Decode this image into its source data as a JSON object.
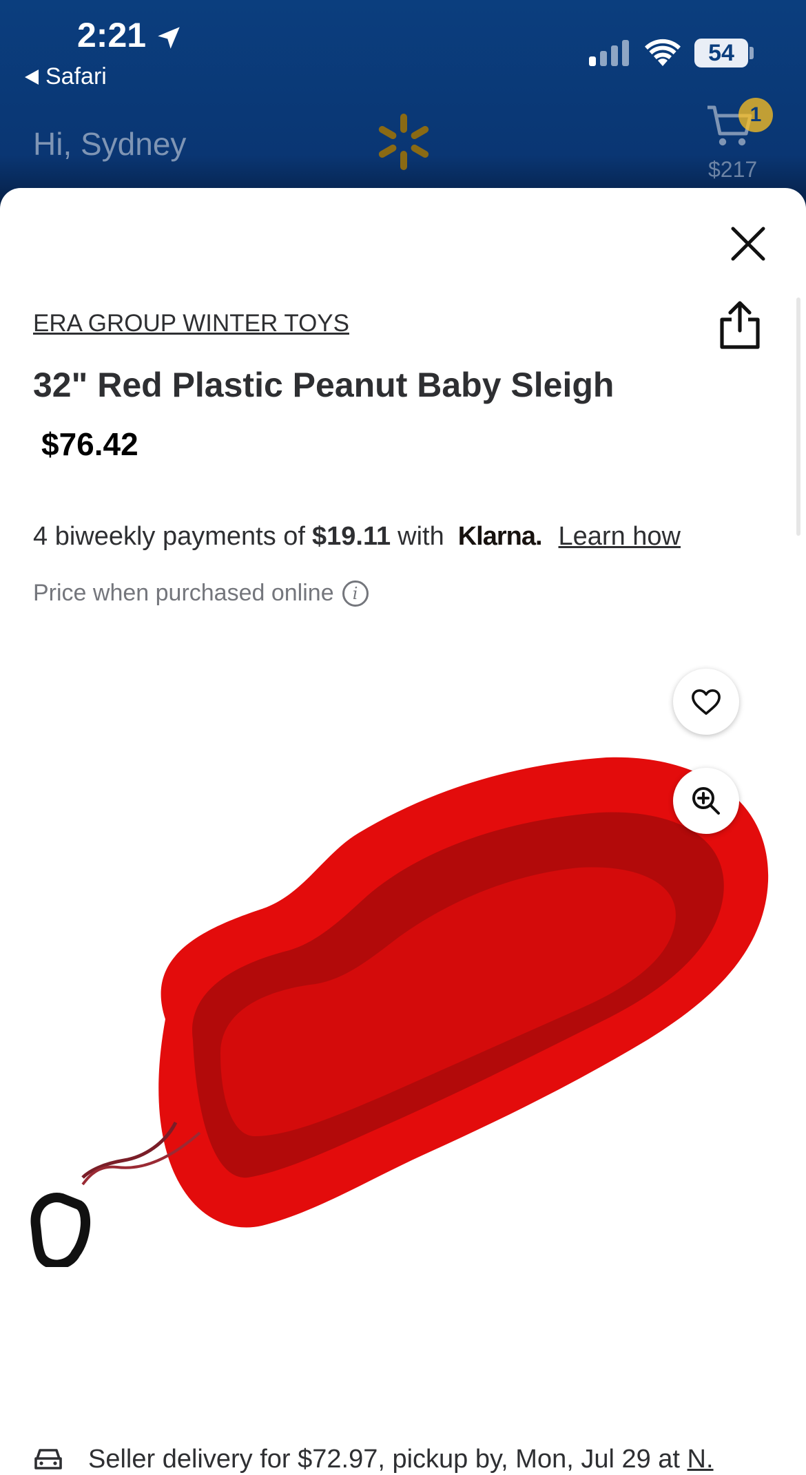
{
  "status_bar": {
    "time": "2:21",
    "back_app": "Safari",
    "battery": "54"
  },
  "header": {
    "greeting": "Hi, Sydney",
    "cart_count": "1",
    "cart_total": "$217",
    "accent": "#ffc220",
    "bar_color": "#0b3e7e"
  },
  "product": {
    "brand": "ERA GROUP WINTER TOYS",
    "title": "32\" Red Plastic Peanut Baby Sleigh",
    "price": "$76.42",
    "klarna": {
      "prefix": "4 biweekly payments of",
      "amount": "$19.11",
      "with": "with",
      "logo": "Klarna.",
      "link": "Learn how"
    },
    "price_note": "Price when purchased online",
    "image_color": "#e30c0c"
  },
  "delivery": {
    "text": "Seller delivery for $72.97, pickup by, Mon, Jul 29 at",
    "link": "N."
  },
  "icons": [
    "location-arrow-icon",
    "back-triangle-icon",
    "signal-icon",
    "wifi-icon",
    "spark-logo-icon",
    "cart-icon",
    "close-icon",
    "share-icon",
    "info-icon",
    "heart-icon",
    "zoom-in-icon",
    "car-icon"
  ]
}
